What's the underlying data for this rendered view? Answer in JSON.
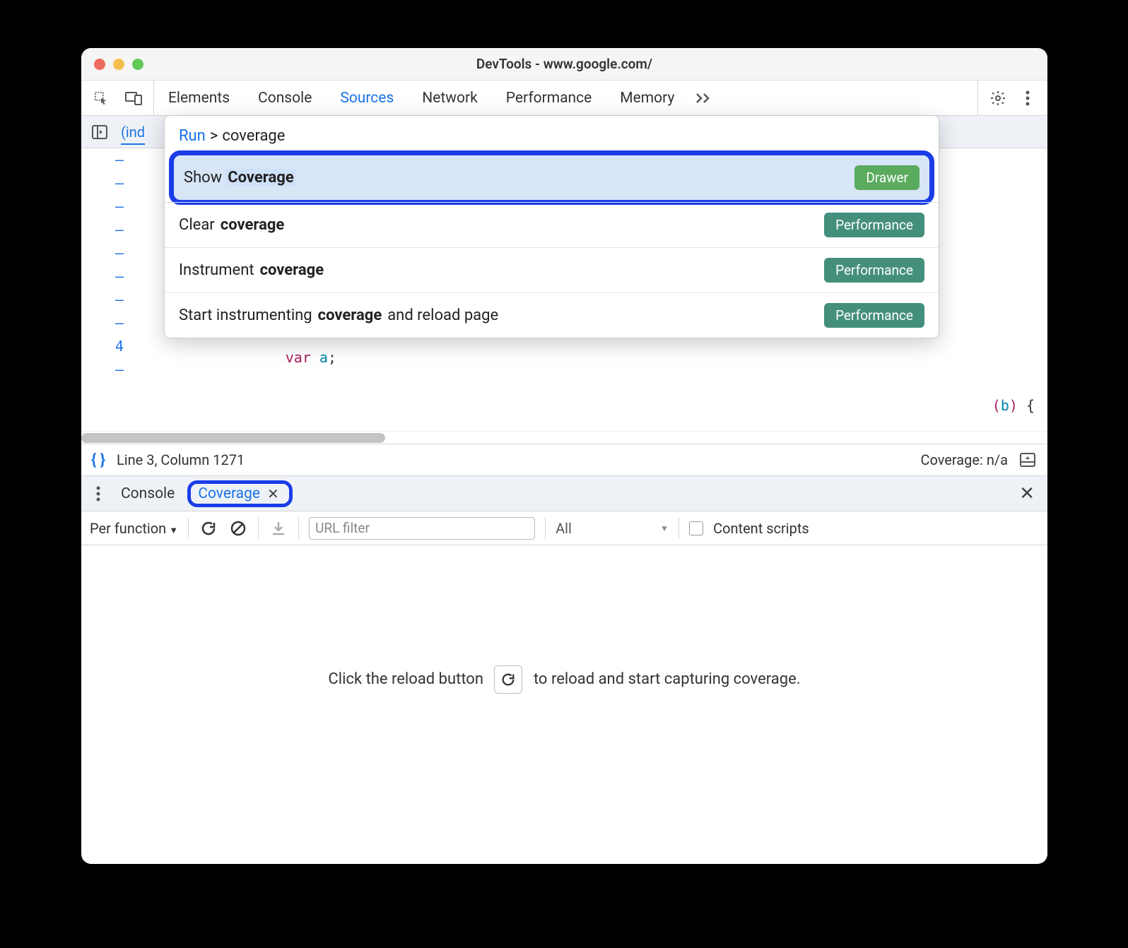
{
  "window": {
    "title": "DevTools - www.google.com/"
  },
  "mainTabs": {
    "items": [
      "Elements",
      "Console",
      "Sources",
      "Network",
      "Performance",
      "Memory"
    ],
    "activeIndex": 2
  },
  "subBar": {
    "file": "(ind"
  },
  "gutter": [
    "–",
    "–",
    "–",
    "–",
    "–",
    "–",
    "–",
    "–",
    "4",
    "–"
  ],
  "code": {
    "line10": {
      "kw": "var",
      "ident": "a",
      "tail": ";"
    },
    "hint": "(b) {"
  },
  "statusBar": {
    "pretty": "{ }",
    "position": "Line 3, Column 1271",
    "coverage": "Coverage: n/a"
  },
  "cmdMenu": {
    "runLabel": "Run",
    "prefix": ">",
    "query": "coverage",
    "items": [
      {
        "text_before": "Show ",
        "match": "Coverage",
        "text_after": "",
        "badge": "Drawer",
        "badgeType": "drawer"
      },
      {
        "text_before": "Clear ",
        "match": "coverage",
        "text_after": "",
        "badge": "Performance",
        "badgeType": "perf"
      },
      {
        "text_before": "Instrument ",
        "match": "coverage",
        "text_after": "",
        "badge": "Performance",
        "badgeType": "perf"
      },
      {
        "text_before": "Start instrumenting ",
        "match": "coverage",
        "text_after": " and reload page",
        "badge": "Performance",
        "badgeType": "perf"
      }
    ]
  },
  "drawer": {
    "tabs": [
      {
        "label": "Console",
        "active": false
      },
      {
        "label": "Coverage",
        "active": true,
        "closable": true
      }
    ]
  },
  "coverageToolbar": {
    "granularity": "Per function",
    "urlFilterPlaceholder": "URL filter",
    "typeFilter": "All",
    "contentScriptsLabel": "Content scripts"
  },
  "coverageEmpty": {
    "pre": "Click the reload button",
    "post": "to reload and start capturing coverage."
  }
}
